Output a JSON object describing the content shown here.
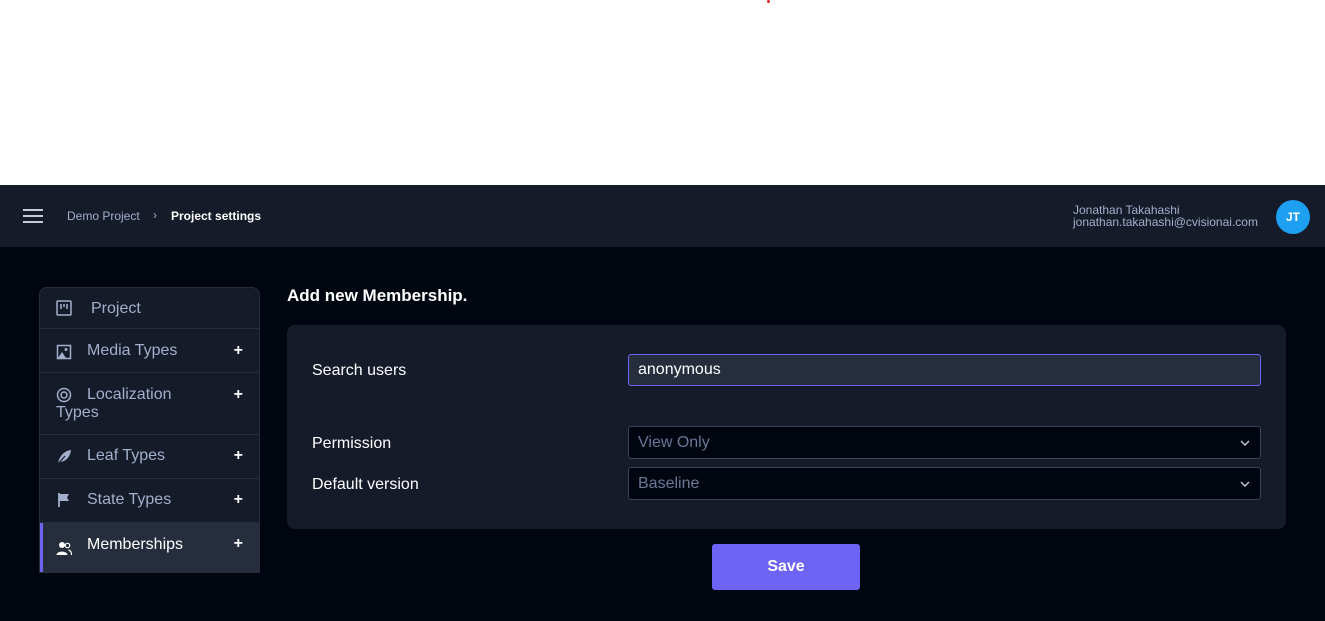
{
  "breadcrumb": {
    "project": "Demo Project",
    "separator": "›",
    "current": "Project settings"
  },
  "user": {
    "name": "Jonathan Takahashi",
    "email": "jonathan.takahashi@cvisionai.com",
    "initials": "JT",
    "avatar_color": "#1ea0f2"
  },
  "sidebar": {
    "items": [
      {
        "label": "Project",
        "icon": "project-board-icon",
        "has_add": false,
        "active": false
      },
      {
        "label": "Media Types",
        "icon": "image-icon",
        "has_add": true,
        "add_label": "+",
        "active": false
      },
      {
        "label_line1": "Localization",
        "label_line2": "Types",
        "icon": "target-icon",
        "has_add": true,
        "add_label": "+",
        "active": false
      },
      {
        "label": "Leaf Types",
        "icon": "leaf-icon",
        "has_add": true,
        "add_label": "+",
        "active": false
      },
      {
        "label": "State Types",
        "icon": "flag-icon",
        "has_add": true,
        "add_label": "+",
        "active": false
      },
      {
        "label": "Memberships",
        "icon": "users-icon",
        "has_add": true,
        "add_label": "+",
        "active": true
      }
    ]
  },
  "main": {
    "title": "Add new Membership.",
    "search_label": "Search users",
    "search_value": "anonymous",
    "permission_label": "Permission",
    "permission_value": "View Only",
    "version_label": "Default version",
    "version_value": "Baseline",
    "save_label": "Save"
  },
  "colors": {
    "accent": "#6d64f5",
    "background": "#00060f",
    "panel": "#151b28"
  }
}
